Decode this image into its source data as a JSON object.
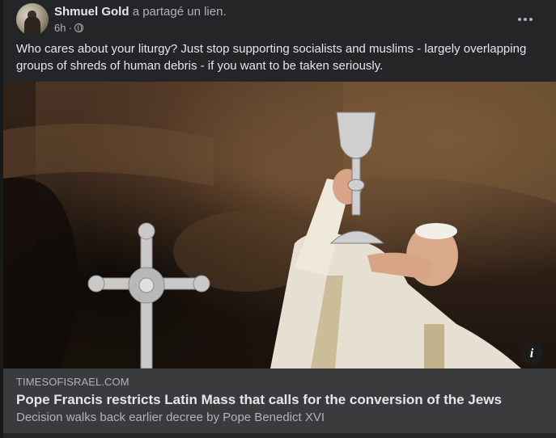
{
  "post": {
    "author_name": "Shmuel Gold",
    "shared_text": "a partagé un lien.",
    "timestamp": "6h",
    "separator": "·",
    "audience_icon": "globe-icon",
    "more_icon": "more-options-icon",
    "text": "Who cares about your liturgy? Just stop supporting socialists and muslims - largely overlapping groups of shreds of human debris - if you want to be taken seriously."
  },
  "link_preview": {
    "image_description_icon": "photo",
    "info_label": "i",
    "domain": "TIMESOFISRAEL.COM",
    "title": "Pope Francis restricts Latin Mass that calls for the conversion of the Jews",
    "subtitle": "Decision walks back earlier decree by Pope Benedict XVI"
  },
  "colors": {
    "background": "#18191a",
    "card": "#242526",
    "link_info_bg": "#3a3b3c",
    "primary_text": "#e4e6eb",
    "secondary_text": "#b0b3b8"
  }
}
